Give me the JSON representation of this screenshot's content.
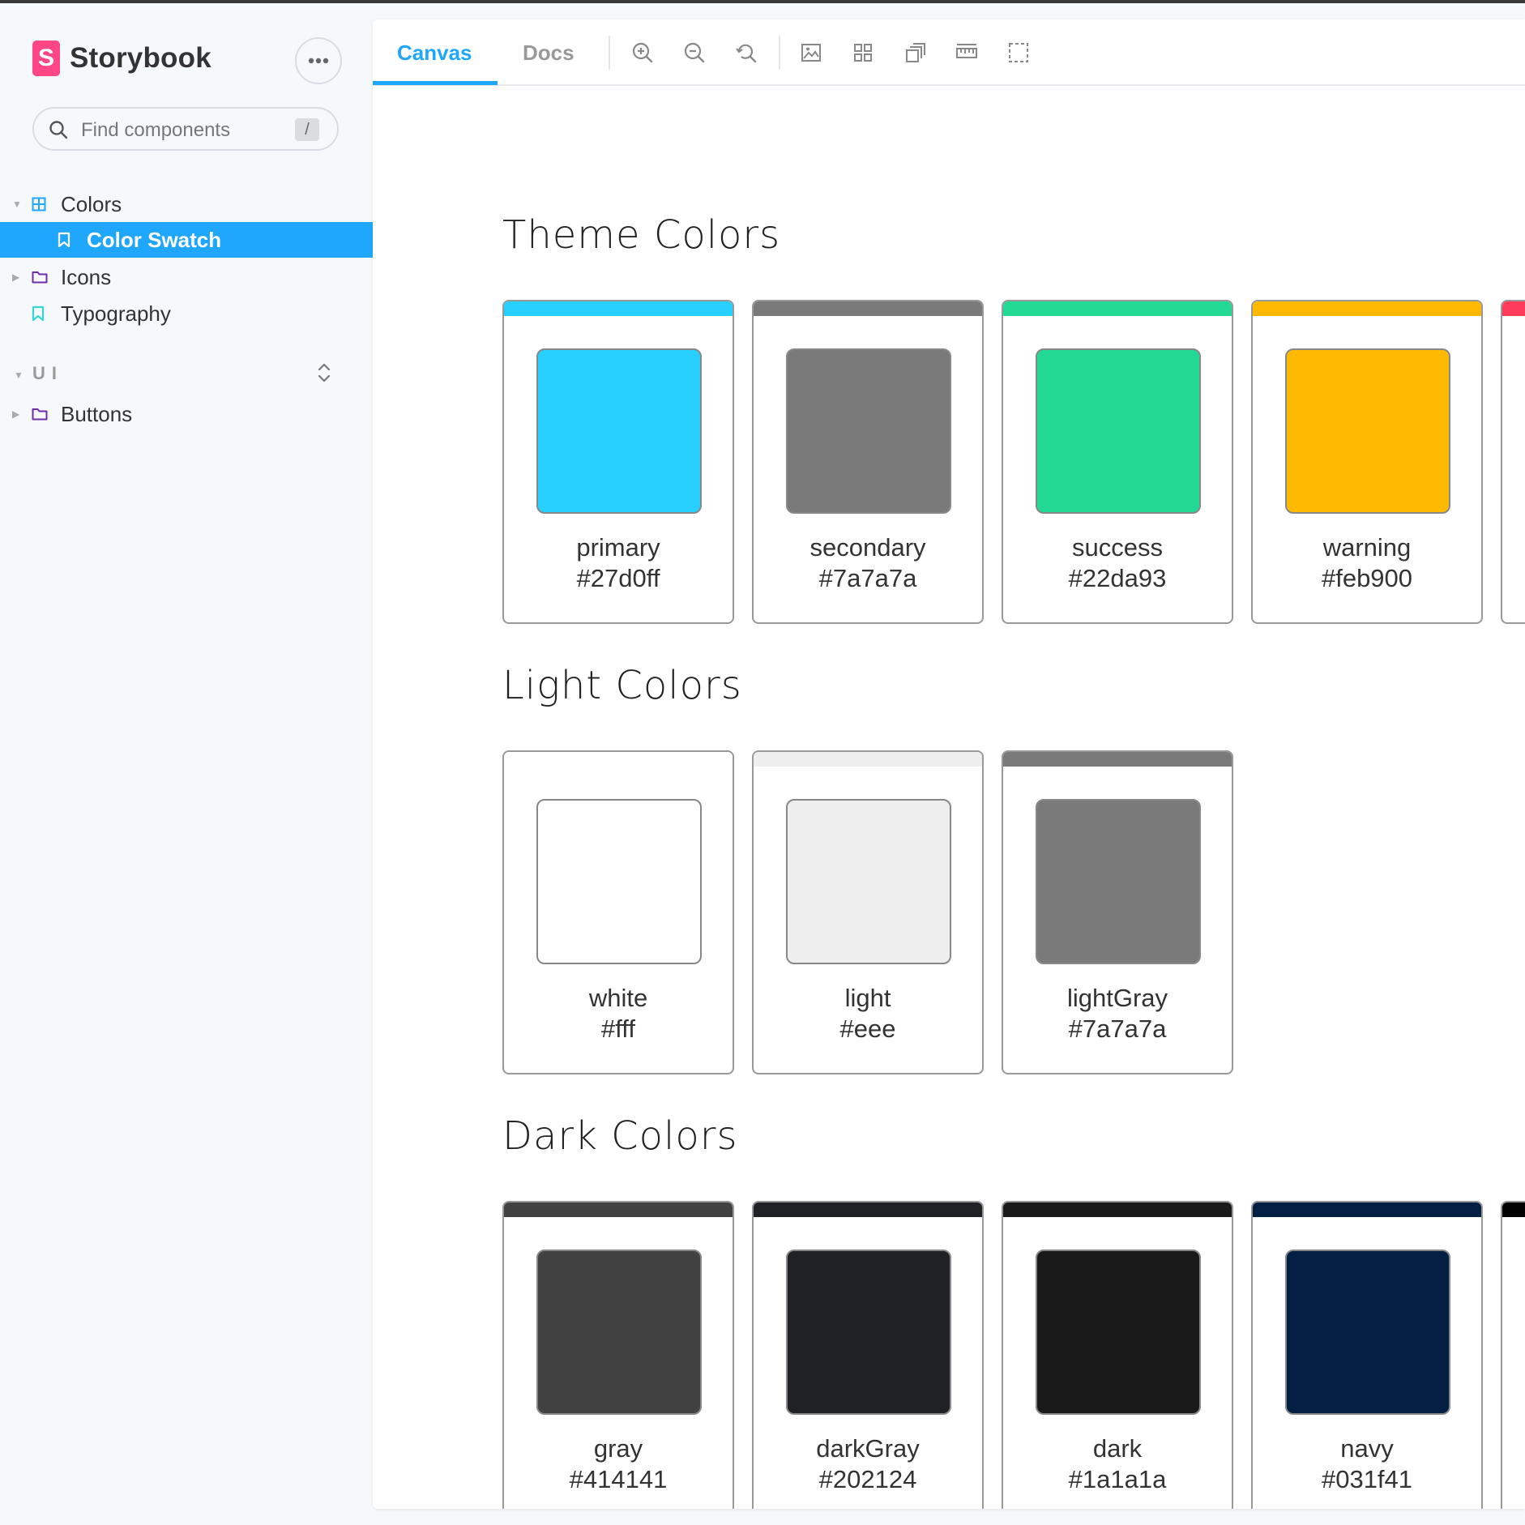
{
  "sidebar": {
    "brand": {
      "name": "Storybook",
      "logo_letter": "S",
      "logo_color": "#ff4785"
    },
    "search": {
      "placeholder": "Find components",
      "shortcut": "/"
    },
    "tree": [
      {
        "label": "Colors",
        "type": "component",
        "expanded": true
      },
      {
        "label": "Color Swatch",
        "type": "story",
        "selected": true
      },
      {
        "label": "Icons",
        "type": "folder",
        "expanded": false
      },
      {
        "label": "Typography",
        "type": "story"
      }
    ],
    "group": {
      "title": "UI",
      "items": [
        {
          "label": "Buttons",
          "type": "folder",
          "expanded": false
        }
      ]
    }
  },
  "toolbar": {
    "tabs": [
      {
        "label": "Canvas",
        "active": true
      },
      {
        "label": "Docs",
        "active": false
      }
    ],
    "tools": [
      "zoom-in-icon",
      "zoom-out-icon",
      "zoom-reset-icon",
      "background-icon",
      "grid-icon",
      "viewport-icon",
      "measure-icon",
      "outline-icon"
    ],
    "accent": "#1ea7fd"
  },
  "sections": [
    {
      "title": "Theme Colors",
      "swatches": [
        {
          "name": "primary",
          "hex": "#27d0ff",
          "color": "#27d0ff"
        },
        {
          "name": "secondary",
          "hex": "#7a7a7a",
          "color": "#7a7a7a"
        },
        {
          "name": "success",
          "hex": "#22da93",
          "color": "#22da93"
        },
        {
          "name": "warning",
          "hex": "#feb900",
          "color": "#feb900"
        }
      ],
      "partial_color": "#ff3b5c"
    },
    {
      "title": "Light Colors",
      "swatches": [
        {
          "name": "white",
          "hex": "#fff",
          "color": "#ffffff"
        },
        {
          "name": "light",
          "hex": "#eee",
          "color": "#eeeeee"
        },
        {
          "name": "lightGray",
          "hex": "#7a7a7a",
          "color": "#7a7a7a"
        }
      ]
    },
    {
      "title": "Dark Colors",
      "swatches": [
        {
          "name": "gray",
          "hex": "#414141",
          "color": "#414141"
        },
        {
          "name": "darkGray",
          "hex": "#202124",
          "color": "#202124"
        },
        {
          "name": "dark",
          "hex": "#1a1a1a",
          "color": "#1a1a1a"
        },
        {
          "name": "navy",
          "hex": "#031f41",
          "color": "#031f41"
        }
      ],
      "partial_color": "#000000"
    }
  ]
}
